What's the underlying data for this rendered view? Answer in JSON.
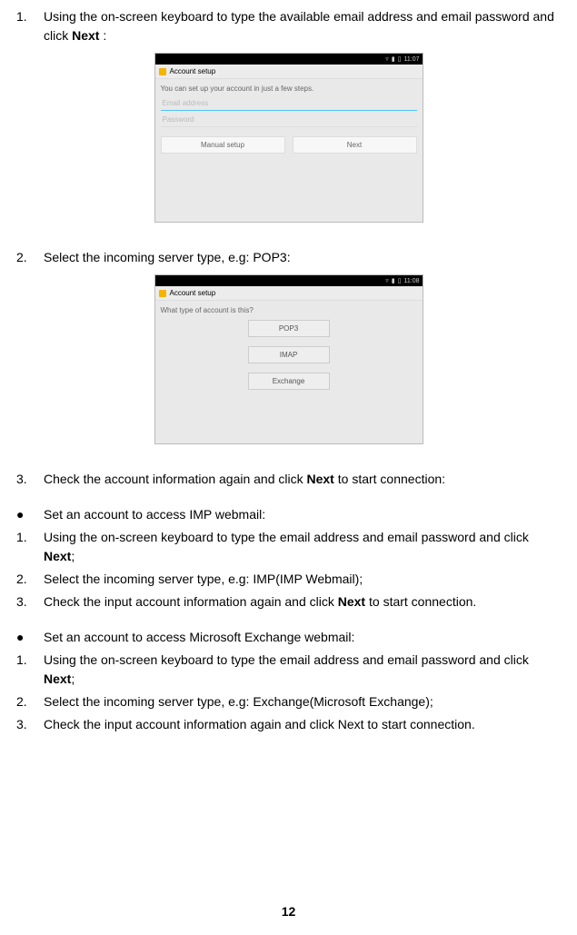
{
  "steps_a": {
    "n1": "1.",
    "t1_a": "Using the on-screen keyboard to type the available email address and email password and click ",
    "t1_b": "Next",
    "t1_c": " :",
    "n2": "2.",
    "t2": "Select the incoming server type, e.g: POP3:",
    "n3": "3.",
    "t3_a": "Check the account information again and click ",
    "t3_b": "Next",
    "t3_c": " to start connection:"
  },
  "section_imp": {
    "bullet": "●",
    "title": "Set an account to access IMP webmail:",
    "n1": "1.",
    "t1_a": "Using the on-screen keyboard to type the email address and email password and click ",
    "t1_b": "Next",
    "t1_c": ";",
    "n2": "2.",
    "t2": "Select the incoming server type, e.g: IMP(IMP Webmail);",
    "n3": "3.",
    "t3_a": "Check the input account information again and click ",
    "t3_b": "Next",
    "t3_c": " to start connection."
  },
  "section_ex": {
    "bullet": "●",
    "title": "Set an account to access Microsoft Exchange webmail:",
    "n1": "1.",
    "t1_a": "Using the on-screen keyboard to type the email address and email password and click ",
    "t1_b": "Next",
    "t1_c": ";",
    "n2": "2.",
    "t2": "Select the incoming server type, e.g: Exchange(Microsoft Exchange);",
    "n3": "3.",
    "t3": "Check the input account information again and click Next to start connection."
  },
  "ss1": {
    "time": "11:07",
    "title": "Account setup",
    "hint": "You can set up your account in just a few steps.",
    "ph_email": "Email address",
    "ph_pass": "Password",
    "btn_manual": "Manual setup",
    "btn_next": "Next"
  },
  "ss2": {
    "time": "11:08",
    "title": "Account setup",
    "hint": "What type of account is this?",
    "btn_pop3": "POP3",
    "btn_imap": "IMAP",
    "btn_exchange": "Exchange"
  },
  "page_number": "12"
}
